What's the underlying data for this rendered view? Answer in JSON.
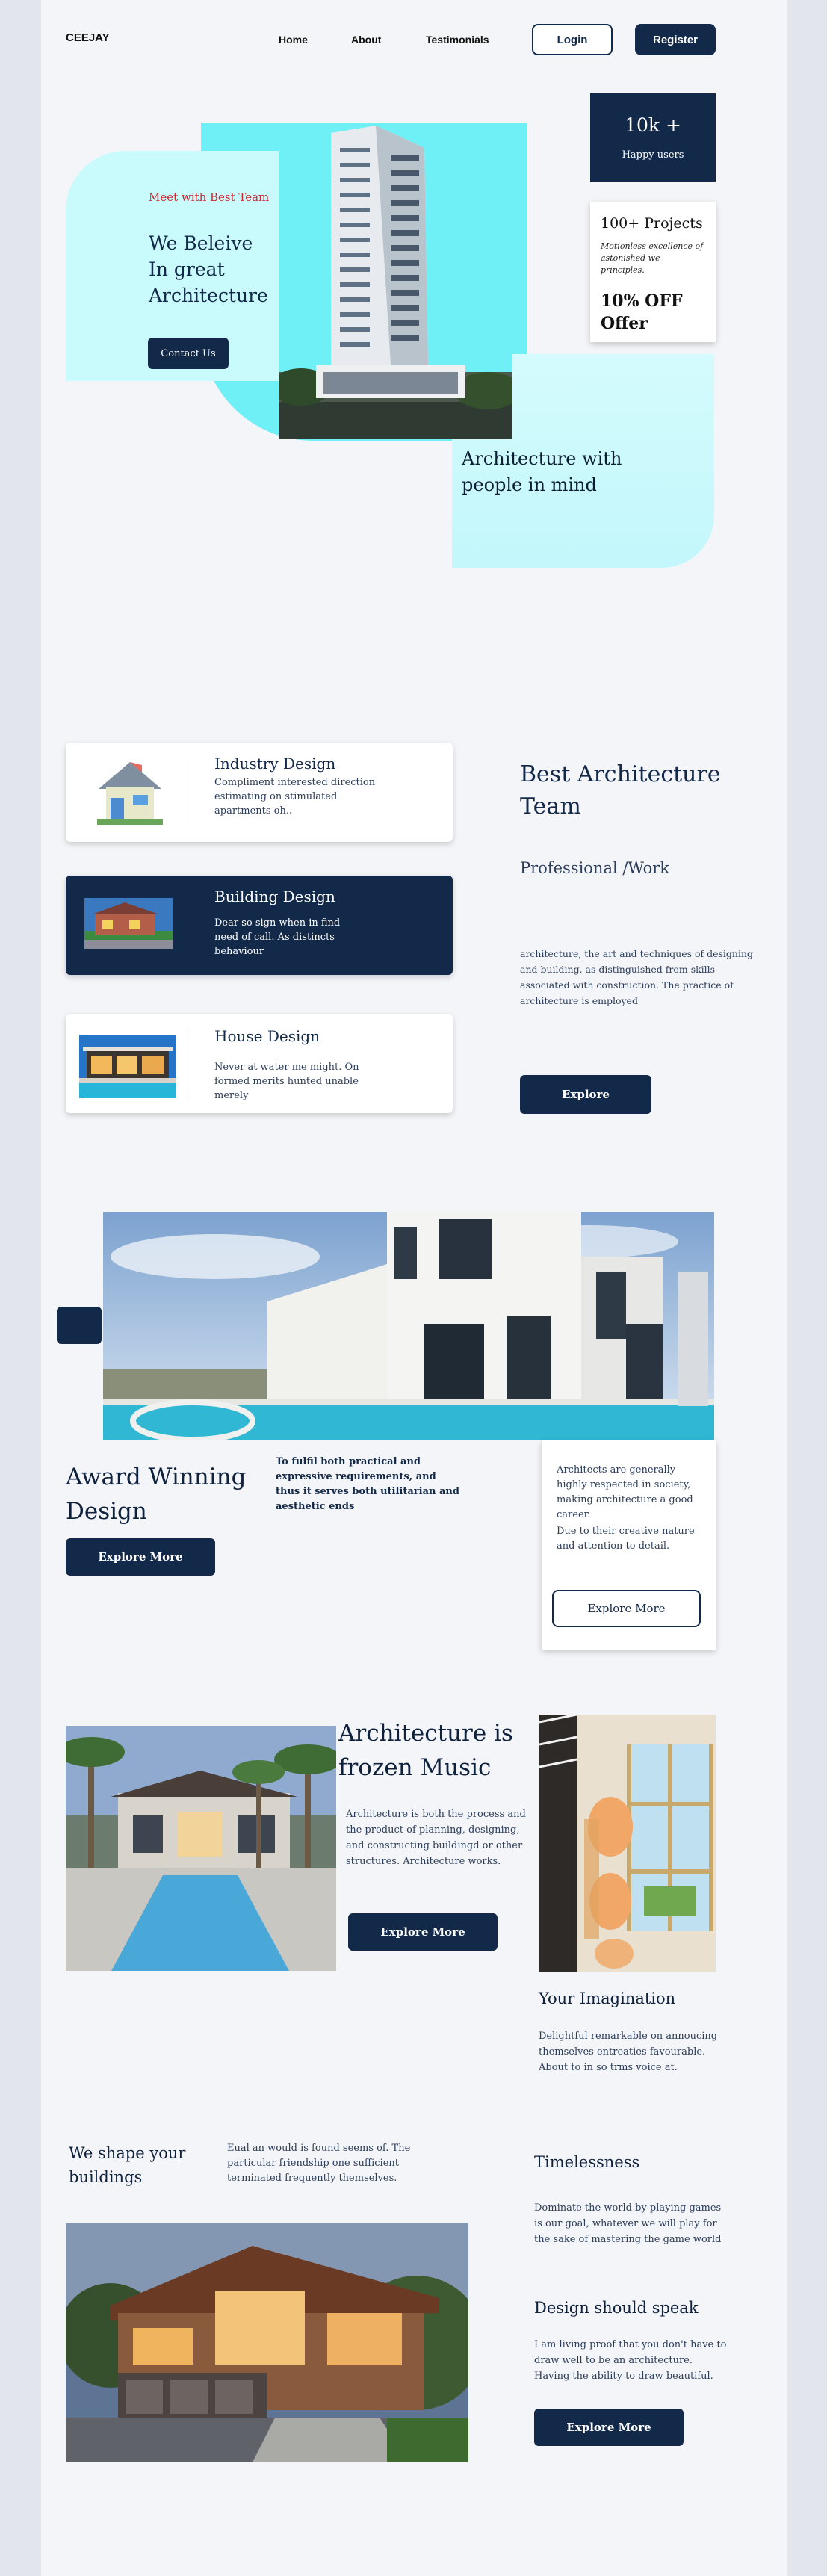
{
  "nav": {
    "logo": "CEEJAY",
    "links": [
      "Home",
      "About",
      "Testimonials"
    ],
    "login": "Login",
    "register": "Register"
  },
  "hero": {
    "tagline": "Meet with Best Team",
    "title_lines": [
      "We Beleive",
      "In great",
      "Architecture"
    ],
    "contact": "Contact Us",
    "stat_value": "10k +",
    "stat_label": "Happy users",
    "projects_title": "100+ Projects",
    "projects_text": "Motionless excellence of astonished we principles.",
    "offer": "10% OFF Offer",
    "mind_title": "Architecture with people in mind"
  },
  "services": {
    "items": [
      {
        "title": "Industry Design",
        "text": "Compliment interested direction estimating on stimulated apartments oh.."
      },
      {
        "title": "Building Design",
        "text": "Dear so sign when in find need of call. As distincts behaviour"
      },
      {
        "title": "House Design",
        "text": "Never at water me might. On formed merits hunted unable merely"
      }
    ],
    "heading": "Best Architecture Team",
    "subheading": "Professional /Work",
    "description": "architecture, the art and techniques of designing and building, as distinguished from skills associated with construction. The practice of architecture is employed",
    "explore": "Explore"
  },
  "award": {
    "title": "Award Winning Design",
    "explore": "Explore More",
    "middle_text": "To fulfil both practical and expressive requirements, and thus it serves both utilitarian and aesthetic ends",
    "card_text1": "Architects are generally highly respected in society, making architecture a good career.",
    "card_text2": "Due to their creative nature and attention to detail.",
    "card_button": "Explore More"
  },
  "music": {
    "title": "Architecture is frozen Music",
    "text": "Architecture is both the process and the product of planning, designing, and constructing buildingd or other structures. Architecture works.",
    "explore": "Explore More",
    "imagination_title": "Your Imagination",
    "imagination_text": "Delightful remarkable on annoucing themselves entreaties favourable. About to in so trms voice at."
  },
  "shape": {
    "title": "We shape your buildings",
    "text": "Eual an would is found seems of. The particular friendship one sufficient terminated frequently themselves.",
    "timeless_title": "Timelessness",
    "timeless_text": "Dominate the world by playing games is our goal, whatever we will play for the sake of mastering the game world",
    "speak_title": "Design should speak",
    "speak_text": "I am living proof that you don't have to draw well to be an architecture. Having the ability to draw beautiful.",
    "explore": "Explore More"
  },
  "colors": {
    "navy": "#13294a",
    "cyan": "#6ff0f6",
    "light_cyan": "#c6f8fb",
    "accent_red": "#d4232c",
    "background": "#f4f5f8"
  }
}
